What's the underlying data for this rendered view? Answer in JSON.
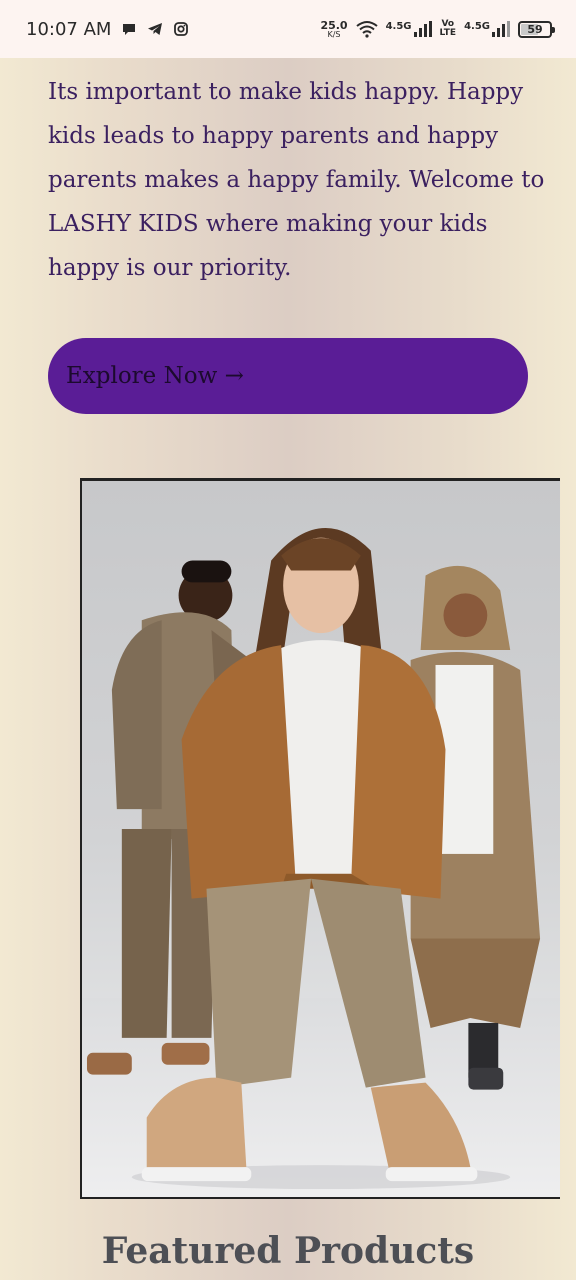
{
  "status_bar": {
    "time": "10:07 AM",
    "speed_value": "25.0",
    "speed_unit": "K/S",
    "network1": "4.5G",
    "volte_top": "Vo",
    "volte_bottom": "LTE",
    "network2": "4.5G",
    "battery": "59",
    "icons": [
      "chat-icon",
      "telegram-icon",
      "instagram-icon",
      "wifi-icon",
      "signal-icon",
      "battery-icon"
    ]
  },
  "intro": {
    "text": "Its important to make kids happy. Happy kids leads to happy parents and happy parents makes a happy family. Welcome to LASHY KIDS where making your kids happy is our priority."
  },
  "cta": {
    "label": "Explore Now →"
  },
  "hero": {
    "description": "Three kids in beige and tan cargo outfits"
  },
  "featured": {
    "heading": "Featured Products"
  },
  "colors": {
    "accent": "#5a1d96",
    "text": "#3b2060",
    "heading": "#4d4f55"
  }
}
